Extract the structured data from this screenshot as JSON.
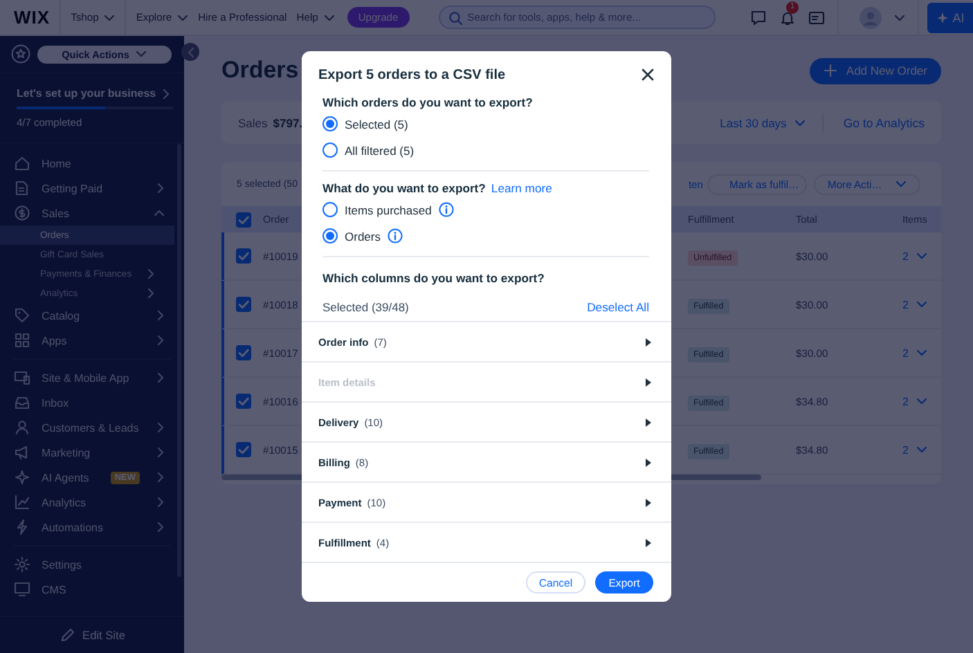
{
  "topbar": {
    "logo": "WIX",
    "site": "Tshop",
    "menu": [
      {
        "label": "Explore",
        "dropdown": true
      },
      {
        "label": "Hire a Professional",
        "dropdown": false
      },
      {
        "label": "Help",
        "dropdown": true
      }
    ],
    "upgrade": "Upgrade",
    "search": {
      "placeholder": "Search for tools, apps, help & more..."
    },
    "notification_count": "1",
    "ai_button": "AI"
  },
  "sidebar": {
    "quick_actions": "Quick Actions",
    "setup": {
      "title": "Let's set up your business",
      "level": 0.57,
      "progress": "4/7 completed"
    },
    "groups": [
      [
        {
          "label": "Home",
          "selected": false,
          "has_submenu": false,
          "expanded": false
        },
        {
          "label": "Getting Paid",
          "selected": false,
          "has_submenu": true,
          "expanded": false
        },
        {
          "label": "Sales",
          "selected": false,
          "has_submenu": true,
          "expanded": true,
          "children": [
            {
              "label": "Orders",
              "selected": true,
              "has_submenu": false
            },
            {
              "label": "Gift Card Sales",
              "selected": false,
              "has_submenu": false
            },
            {
              "label": "Payments & Finances",
              "selected": false,
              "has_submenu": true
            },
            {
              "label": "Analytics",
              "selected": false,
              "has_submenu": true
            }
          ]
        },
        {
          "label": "Catalog",
          "selected": false,
          "has_submenu": true,
          "expanded": false
        },
        {
          "label": "Apps",
          "selected": false,
          "has_submenu": true,
          "expanded": false
        }
      ],
      [
        {
          "label": "Site & Mobile App",
          "selected": false,
          "has_submenu": true,
          "expanded": false
        },
        {
          "label": "Inbox",
          "selected": false,
          "has_submenu": false,
          "expanded": false
        },
        {
          "label": "Customers & Leads",
          "selected": false,
          "has_submenu": true,
          "expanded": false
        },
        {
          "label": "Marketing",
          "selected": false,
          "has_submenu": true,
          "expanded": false
        },
        {
          "label": "AI Agents",
          "badge": "NEW",
          "selected": false,
          "has_submenu": true,
          "expanded": false
        },
        {
          "label": "Analytics",
          "selected": false,
          "has_submenu": true,
          "expanded": false
        },
        {
          "label": "Automations",
          "selected": false,
          "has_submenu": true,
          "expanded": false
        }
      ],
      [
        {
          "label": "Settings",
          "selected": false,
          "has_submenu": false,
          "expanded": false
        },
        {
          "label": "CMS",
          "selected": false,
          "has_submenu": false,
          "expanded": false
        }
      ]
    ],
    "footer": "Edit Site"
  },
  "main": {
    "title": "Orders",
    "add_button": "Add New Order",
    "sales": {
      "label": "Sales",
      "value": "$797.",
      "period": "Last 30 days",
      "analytics_link": "Go to Analytics"
    },
    "table": {
      "selection": "5 selected (50",
      "actions": [
        {
          "label": "ten",
          "kind": "plain"
        },
        {
          "label": "Mark as fulfil…",
          "kind": "check"
        },
        {
          "label": "More Acti…",
          "kind": "menu"
        }
      ],
      "columns": [
        "Order",
        "Fulfillment",
        "Total",
        "Items"
      ],
      "header_checked": true,
      "rows": [
        {
          "checked": true,
          "order": "#10019",
          "fulfillment": "Unfulfilled",
          "fulfilled": false,
          "total": "$30.00",
          "items": "2"
        },
        {
          "checked": true,
          "order": "#10018",
          "fulfillment": "Fulfilled",
          "fulfilled": true,
          "total": "$30.00",
          "items": "2"
        },
        {
          "checked": true,
          "order": "#10017",
          "fulfillment": "Fulfilled",
          "fulfilled": true,
          "total": "$30.00",
          "items": "2"
        },
        {
          "checked": true,
          "order": "#10016",
          "fulfillment": "Fulfilled",
          "fulfilled": true,
          "total": "$34.80",
          "items": "2"
        },
        {
          "checked": true,
          "order": "#10015",
          "fulfillment": "Fulfilled",
          "fulfilled": true,
          "total": "$34.80",
          "items": "2"
        }
      ]
    }
  },
  "dialog": {
    "title": "Export 5 orders to a CSV file",
    "groups": [
      {
        "question": "Which orders do you want to export?",
        "options": [
          {
            "label": "Selected (5)",
            "selected": true,
            "info": false
          },
          {
            "label": "All filtered (5)",
            "selected": false,
            "info": false
          }
        ]
      },
      {
        "question": "What do you want to export?",
        "link": "Learn more",
        "options": [
          {
            "label": "Items purchased",
            "selected": false,
            "info": true
          },
          {
            "label": "Orders",
            "selected": true,
            "info": true
          }
        ]
      }
    ],
    "columns_question": "Which columns do you want to export?",
    "columns_count": "Selected (39/48)",
    "deselect": "Deselect All",
    "sections": [
      {
        "name": "Order info",
        "count": "(7)",
        "disabled": false
      },
      {
        "name": "Item details",
        "disabled": true
      },
      {
        "name": "Delivery",
        "count": "(10)",
        "disabled": false
      },
      {
        "name": "Billing",
        "count": "(8)",
        "disabled": false
      },
      {
        "name": "Payment",
        "count": "(10)",
        "disabled": false
      },
      {
        "name": "Fulfillment",
        "count": "(4)",
        "disabled": false
      }
    ],
    "cancel": "Cancel",
    "export": "Export"
  }
}
